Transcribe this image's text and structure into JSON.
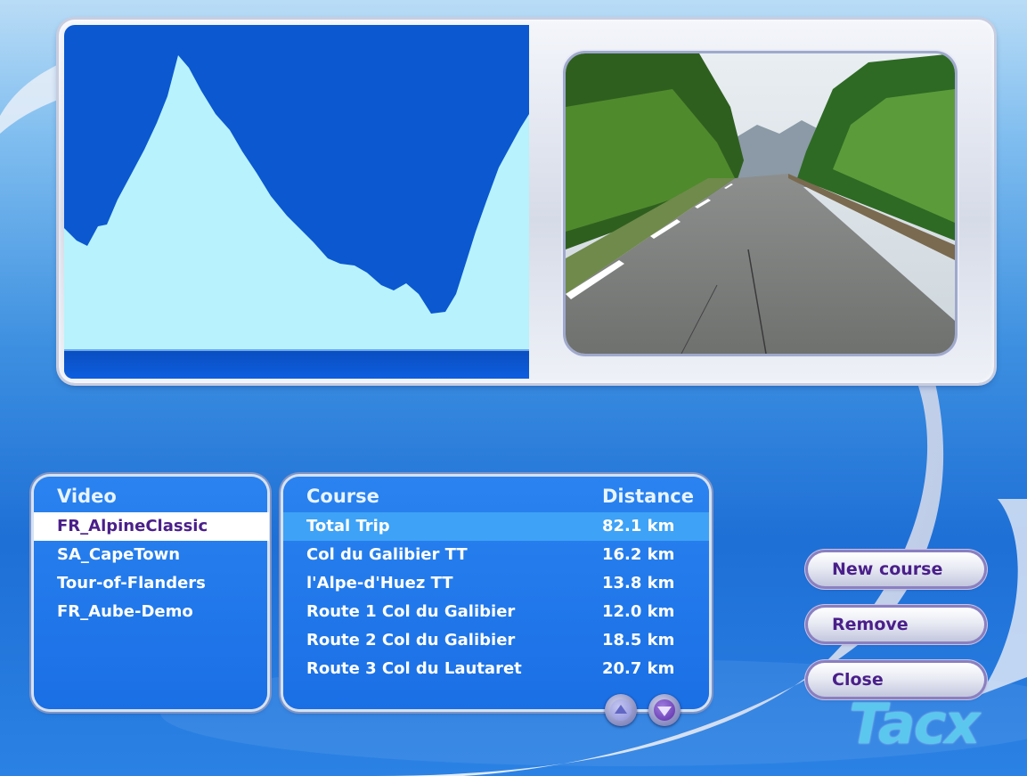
{
  "video_list": {
    "header": "Video",
    "items": [
      "FR_AlpineClassic",
      "SA_CapeTown",
      "Tour-of-Flanders",
      "FR_Aube-Demo"
    ],
    "selected_index": 0
  },
  "course_list": {
    "header_course": "Course",
    "header_distance": "Distance",
    "rows": [
      {
        "name": "Total Trip",
        "distance": "82.1 km"
      },
      {
        "name": "Col du Galibier  TT",
        "distance": "16.2 km"
      },
      {
        "name": "l'Alpe-d'Huez TT",
        "distance": "13.8 km"
      },
      {
        "name": "Route 1 Col du Galibier",
        "distance": "12.0 km"
      },
      {
        "name": "Route 2 Col du Galibier",
        "distance": "18.5 km"
      },
      {
        "name": "Route 3 Col du Lautaret",
        "distance": "20.7 km"
      }
    ],
    "selected_index": 0
  },
  "buttons": {
    "new_course": "New course",
    "remove": "Remove",
    "close": "Close"
  },
  "logo": "Tacx",
  "colors": {
    "profile_fill": "#b8f2fc",
    "profile_bg": "#0b58d0",
    "button_text": "#4a1f8a",
    "logo": "#5cc7ee"
  },
  "icons": [
    "scroll-up-icon",
    "scroll-down-icon"
  ]
}
